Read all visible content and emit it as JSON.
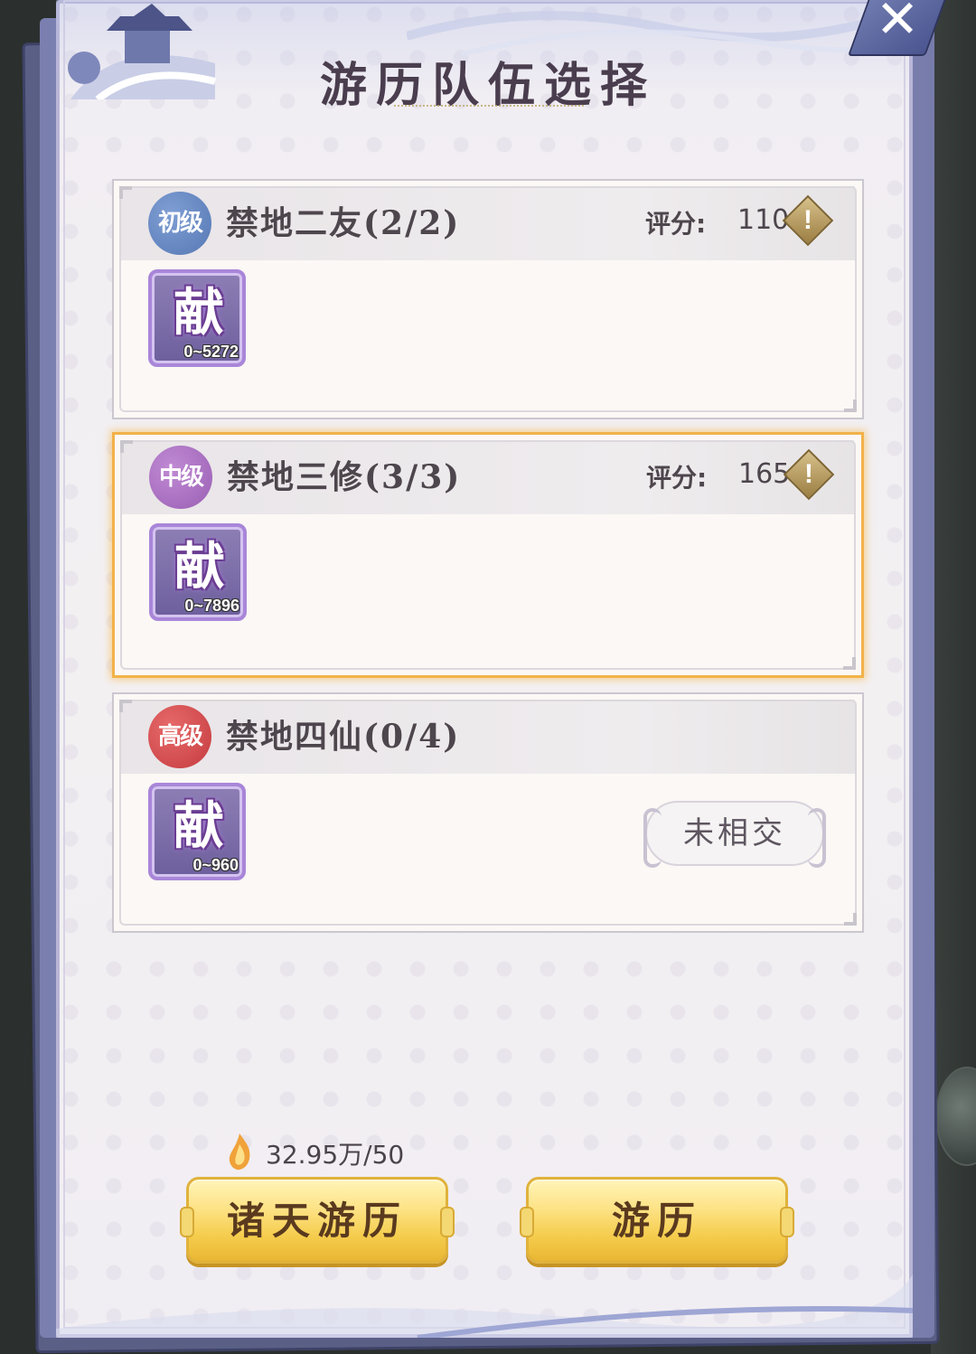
{
  "window": {
    "title": "游历队伍选择"
  },
  "close": {
    "label": "✕"
  },
  "teams": [
    {
      "tier": "初级",
      "name": "禁地二友(2/2)",
      "score_label": "评分:",
      "score": "110",
      "item_glyph": "献",
      "item_range": "0~5272",
      "selected": false,
      "status": ""
    },
    {
      "tier": "中级",
      "name": "禁地三修(3/3)",
      "score_label": "评分:",
      "score": "165",
      "item_glyph": "献",
      "item_range": "0~7896",
      "selected": true,
      "status": ""
    },
    {
      "tier": "高级",
      "name": "禁地四仙(0/4)",
      "score_label": "",
      "score": "",
      "item_glyph": "献",
      "item_range": "0~960",
      "selected": false,
      "status": "未相交"
    }
  ],
  "cost": {
    "text": "32.95万/50",
    "icon": "flame-icon"
  },
  "buttons": {
    "all_heavens": "诸天游历",
    "travel": "游历"
  },
  "colors": {
    "selected_border": "#f2b24a",
    "badge_primary": "#5678b4",
    "badge_mid": "#9a5fb4",
    "badge_high": "#c53b3f",
    "gold_button": "#f5cc4c"
  }
}
